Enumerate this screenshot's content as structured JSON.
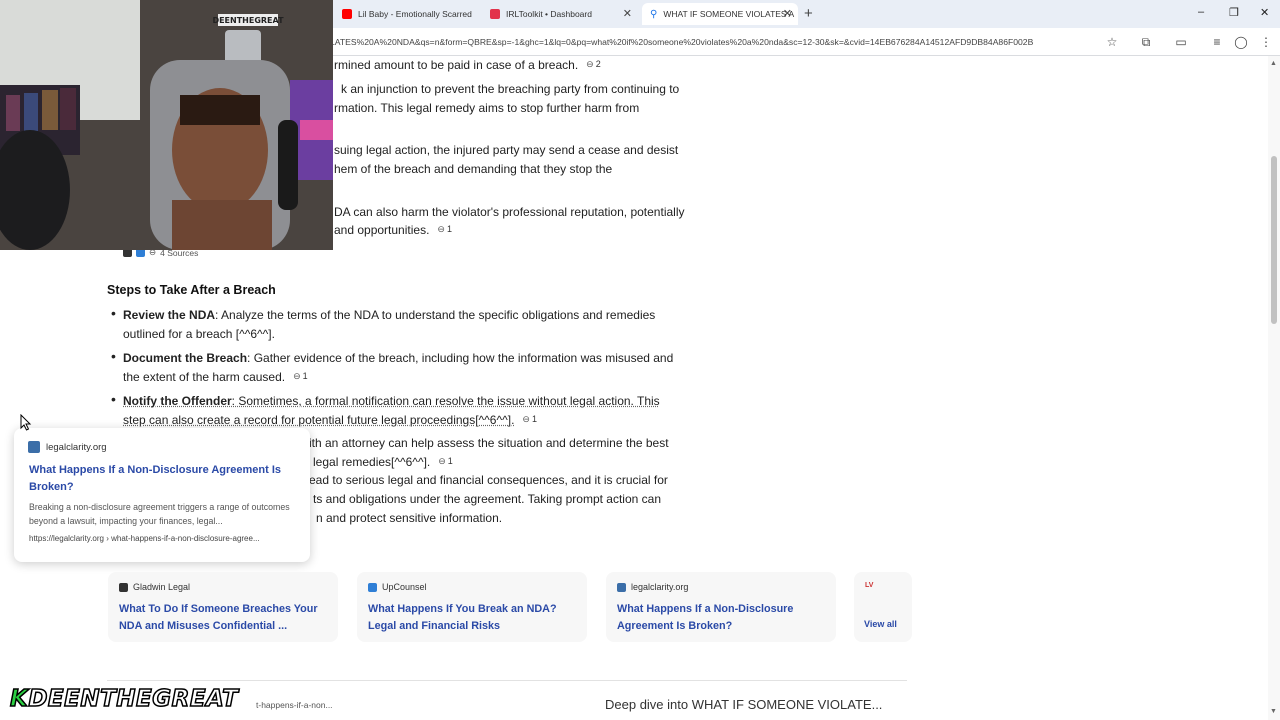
{
  "browser": {
    "tabs": [
      {
        "title": "Lil Baby - Emotionally Scarred",
        "favicon_color": "#ff0000"
      },
      {
        "title": "IRLToolkit • Dashboard",
        "favicon_color": "#e2334b"
      },
      {
        "title": "WHAT IF SOMEONE VIOLATES A",
        "favicon_color": "#1a73e8",
        "active": true
      }
    ],
    "new_tab": "+",
    "window_controls": {
      "minimize": "–",
      "maximize": "❐",
      "close": "✕"
    },
    "url": "LATES%20A%20NDA&qs=n&form=QBRE&sp=-1&ghc=1&lq=0&pq=what%20if%20someone%20violates%20a%20nda&sc=12-30&sk=&cvid=14EB676284A14512AFD9DB84A86F002B",
    "toolbar_icons": [
      "star-icon",
      "extensions-icon",
      "split-screen-icon",
      "collections-icon",
      "profile-icon",
      "menu-icon"
    ]
  },
  "answer": {
    "partial_lines": [
      "rmined amount to be paid in case of a breach.",
      "k an injunction to prevent the breaching party from continuing to",
      "rmation. This legal remedy aims to stop further harm from",
      "suing legal action, the injured party may send a cease and desist",
      "hem of the breach and demanding that they stop the",
      "DA can also harm the violator's professional reputation, potentially",
      "and opportunities."
    ],
    "citation_counts": {
      "c1": "2",
      "c2": "1"
    },
    "sources_label": "4 Sources"
  },
  "steps": {
    "heading": "Steps to Take After a Breach",
    "items": [
      {
        "bold": "Review the NDA",
        "text_line1": ": Analyze the terms of the NDA to understand the specific obligations and remedies",
        "text_line2": "outlined for a breach [^^6^^]."
      },
      {
        "bold": "Document the Breach",
        "text_line1": ": Gather evidence of the breach, including how the information was misused and",
        "text_line2": "the extent of the harm caused.",
        "cite": "1"
      },
      {
        "bold": "Notify the Offender",
        "text_line1": ": Sometimes, a formal notification can resolve the issue without legal action. This",
        "text_line2": "step can also create a record for potential future legal proceedings[^^6^^].",
        "cite": "1"
      },
      {
        "text_line1": "ith an attorney can help assess the situation and determine the best",
        "text_line2": "legal remedies[^^6^^].",
        "cite": "1"
      }
    ],
    "conclusion_lines": [
      "ead to serious legal and financial consequences, and it is crucial for",
      "ts and obligations under the agreement. Taking prompt action can",
      "n and protect sensitive information."
    ]
  },
  "hover_card": {
    "site": "legalclarity.org",
    "title": "What Happens If a Non-Disclosure Agreement Is Broken?",
    "snippet": "Breaking a non-disclosure agreement triggers a range of outcomes beyond a lawsuit, impacting your finances, legal...",
    "url": "https://legalclarity.org › what-happens-if-a-non-disclosure-agree..."
  },
  "source_cards": [
    {
      "site": "Gladwin Legal",
      "title": "What To Do If Someone Breaches Your NDA and Misuses Confidential ...",
      "favicon_color": "#333333"
    },
    {
      "site": "UpCounsel",
      "title": "What Happens If You Break an NDA? Legal and Financial Risks",
      "favicon_color": "#2f7fd6"
    },
    {
      "site": "legalclarity.org",
      "title": "What Happens If a Non-Disclosure Agreement Is Broken?",
      "favicon_color": "#3b6ea8"
    }
  ],
  "view_all": "View all",
  "bottom": {
    "left_link": "t-happens-if-a-non...",
    "deep_dive": "Deep dive into WHAT IF SOMEONE VIOLATE..."
  },
  "overlay": {
    "watermark_k": "K",
    "watermark_rest": "DEENTHEGREAT",
    "cam_sign": "DEENTHEGREAT"
  }
}
